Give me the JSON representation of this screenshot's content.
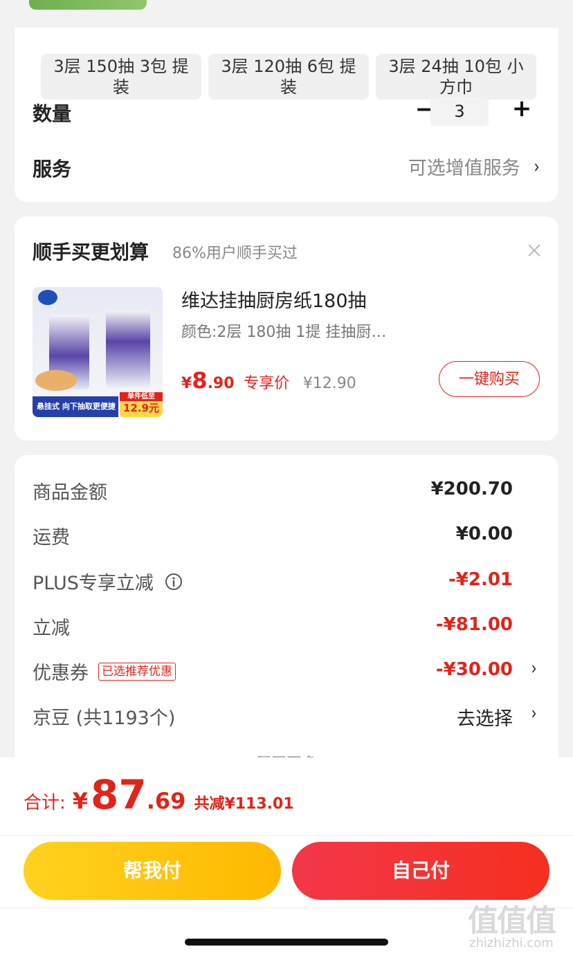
{
  "variants": [
    "3层 150抽 3包 提装",
    "3层 120抽 6包 提装",
    "3层 24抽 10包 小方巾"
  ],
  "quantity": {
    "label": "数量",
    "value": "3",
    "minus": "−",
    "plus": "+"
  },
  "service": {
    "label": "服务",
    "placeholder": "可选增值服务"
  },
  "addon": {
    "title": "顺手买更划算",
    "subtitle": "86%用户顺手买过",
    "product_name": "维达挂抽厨房纸180抽",
    "product_spec": "颜色:2层 180抽 1提 挂抽厨…",
    "currency": "¥",
    "price_int": "8",
    "price_dec": ".90",
    "price_tag": "专享价",
    "original_price": "¥12.90",
    "buy_button": "一键购买",
    "img_banner": "悬挂式 向下抽取更便捷",
    "img_badge_top": "单件低至",
    "img_badge_price": "12.9元"
  },
  "summary": {
    "rows": [
      {
        "label": "商品金额",
        "value": "¥200.70"
      },
      {
        "label": "运费",
        "value": "¥0.00"
      },
      {
        "label": "PLUS专享立减",
        "value": "-¥2.01"
      },
      {
        "label": "立减",
        "value": "-¥81.00"
      },
      {
        "label": "优惠券",
        "tag": "已选推荐优惠",
        "value": "-¥30.00"
      },
      {
        "label": "京豆 (共1193个)",
        "value": "去选择"
      }
    ],
    "expand_more": "展开更多"
  },
  "footer": {
    "total_label": "合计:",
    "currency": "¥",
    "total_int": "87",
    "total_dec": ".69",
    "discount": "共减¥113.01",
    "help_pay": "帮我付",
    "self_pay": "自己付"
  },
  "watermark": {
    "logo": "值值值",
    "url": "zhizhizhi.com"
  },
  "colors": {
    "accent_red": "#e2231a",
    "yellow_start": "#ffd21e",
    "yellow_end": "#ffb800",
    "red_start": "#f2374a",
    "red_end": "#f6301e"
  }
}
